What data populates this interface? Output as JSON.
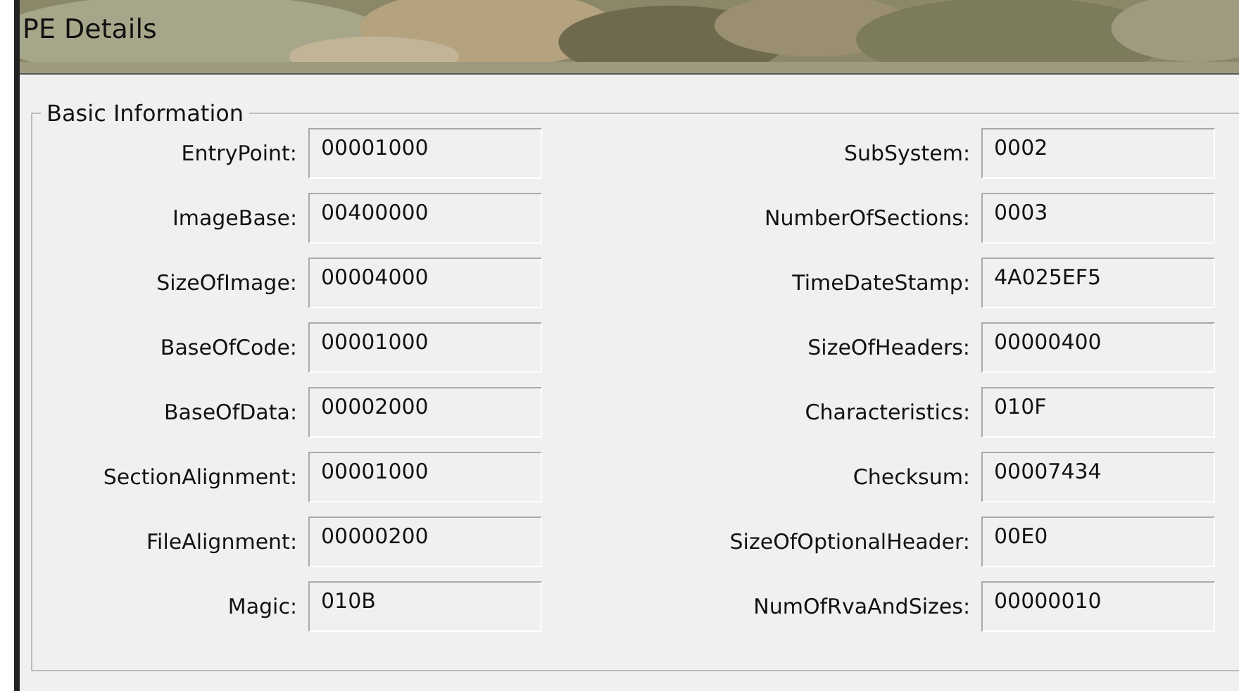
{
  "window": {
    "title": "PE Details"
  },
  "group": {
    "title": "Basic Information",
    "left": [
      {
        "label": "EntryPoint:",
        "value": "00001000"
      },
      {
        "label": "ImageBase:",
        "value": "00400000"
      },
      {
        "label": "SizeOfImage:",
        "value": "00004000"
      },
      {
        "label": "BaseOfCode:",
        "value": "00001000"
      },
      {
        "label": "BaseOfData:",
        "value": "00002000"
      },
      {
        "label": "SectionAlignment:",
        "value": "00001000"
      },
      {
        "label": "FileAlignment:",
        "value": "00000200"
      },
      {
        "label": "Magic:",
        "value": "010B"
      }
    ],
    "right": [
      {
        "label": "SubSystem:",
        "value": "0002"
      },
      {
        "label": "NumberOfSections:",
        "value": "0003"
      },
      {
        "label": "TimeDateStamp:",
        "value": "4A025EF5"
      },
      {
        "label": "SizeOfHeaders:",
        "value": "00000400"
      },
      {
        "label": "Characteristics:",
        "value": "010F"
      },
      {
        "label": "Checksum:",
        "value": "00007434"
      },
      {
        "label": "SizeOfOptionalHeader:",
        "value": "00E0"
      },
      {
        "label": "NumOfRvaAndSizes:",
        "value": "00000010"
      }
    ]
  }
}
